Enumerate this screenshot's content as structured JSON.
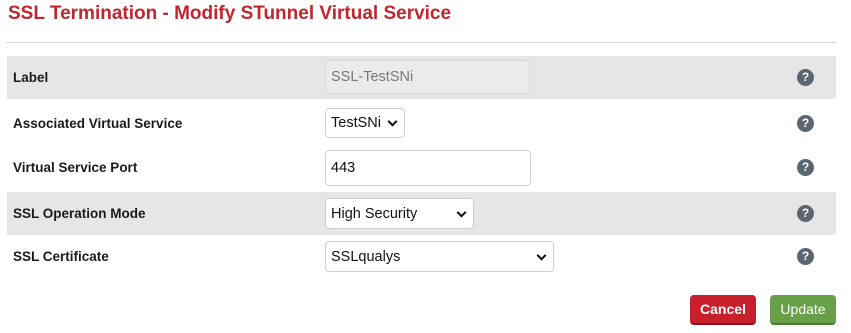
{
  "page": {
    "title": "SSL Termination - Modify STunnel Virtual Service"
  },
  "form": {
    "rows": [
      {
        "label": "Label",
        "value": "SSL-TestSNi",
        "type": "readonly-text"
      },
      {
        "label": "Associated Virtual Service",
        "value": "TestSNi",
        "type": "select"
      },
      {
        "label": "Virtual Service Port",
        "value": "443",
        "type": "text"
      },
      {
        "label": "SSL Operation Mode",
        "value": "High Security",
        "type": "select"
      },
      {
        "label": "SSL Certificate",
        "value": "SSLqualys",
        "type": "select"
      }
    ],
    "help_icon_glyph": "?"
  },
  "actions": {
    "cancel_label": "Cancel",
    "update_label": "Update"
  },
  "colors": {
    "title": "#c0262e",
    "row_shade": "#e6e6e6",
    "help_icon": "#5b6670",
    "cancel": "#c8202a",
    "update": "#68a04a"
  },
  "icons": {
    "help": "question-mark-circle-icon",
    "dropdown": "chevron-down-icon"
  }
}
